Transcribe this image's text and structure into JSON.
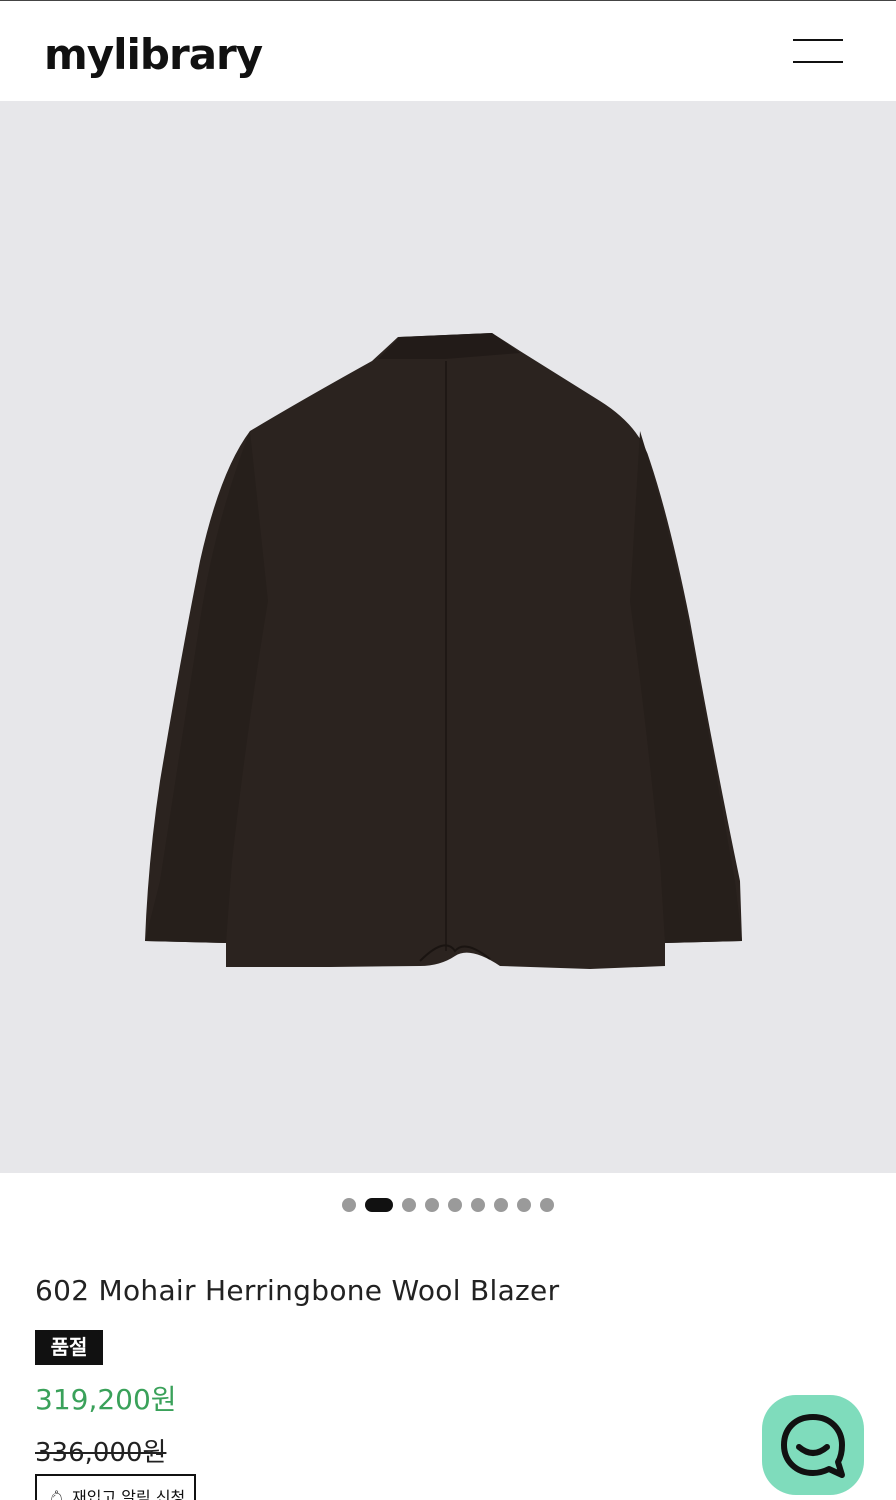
{
  "header": {
    "logo_text": "mylibrary",
    "menu_icon": "hamburger-icon"
  },
  "gallery": {
    "image_description_icon": "product-photo",
    "slide_count": 9,
    "active_slide": 2
  },
  "product": {
    "title": "602 Mohair Herringbone Wool Blazer",
    "badge": "품절",
    "sale_price": "319,200원",
    "original_price": "336,000원",
    "restock_button": "재입고 알림 신청"
  },
  "chat": {
    "icon": "chat-icon"
  },
  "colors": {
    "accent_price": "#3aa15a",
    "chat_bg": "#7fdcbc",
    "gallery_bg": "#e7e7ea"
  }
}
